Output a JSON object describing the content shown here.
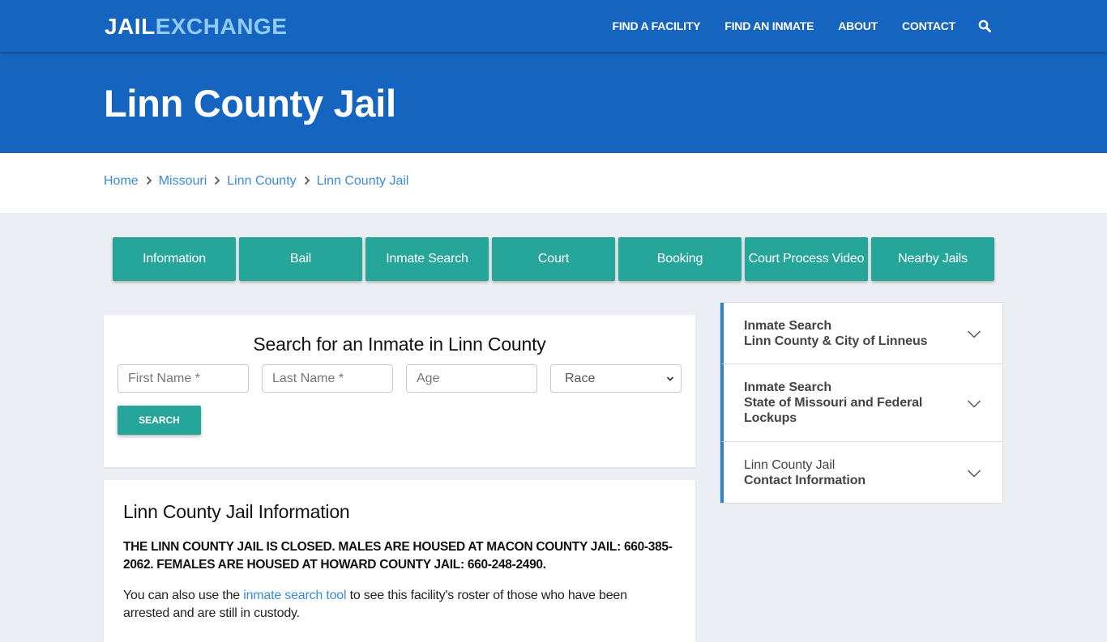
{
  "header": {
    "logo_part1": "JAIL",
    "logo_part2": "EXCHANGE",
    "nav": [
      {
        "label": "FIND A FACILITY"
      },
      {
        "label": "FIND AN INMATE"
      },
      {
        "label": "ABOUT"
      },
      {
        "label": "CONTACT"
      }
    ],
    "search_icon": "search-icon"
  },
  "hero": {
    "title": "Linn County Jail"
  },
  "breadcrumb": [
    {
      "label": "Home"
    },
    {
      "label": "Missouri"
    },
    {
      "label": "Linn County"
    },
    {
      "label": "Linn County Jail"
    }
  ],
  "tabs": [
    {
      "label": "Information"
    },
    {
      "label": "Bail"
    },
    {
      "label": "Inmate Search"
    },
    {
      "label": "Court"
    },
    {
      "label": "Booking"
    },
    {
      "label": "Court Process Video"
    },
    {
      "label": "Nearby Jails"
    }
  ],
  "search": {
    "title": "Search for an Inmate in Linn County",
    "first_name_placeholder": "First Name *",
    "last_name_placeholder": "Last Name *",
    "age_placeholder": "Age",
    "race_selected": "Race",
    "button_label": "SEARCH"
  },
  "info": {
    "title": "Linn County Jail Information",
    "alert": "THE LINN COUNTY JAIL IS CLOSED.  MALES ARE HOUSED AT MACON COUNTY JAIL: 660-385-2062.  FEMALES ARE HOUSED AT HOWARD COUNTY JAIL: 660-248-2490.",
    "para_before": "You can also use the ",
    "para_link": "inmate search tool",
    "para_after": " to see this facility's roster of those who have been arrested and are still in custody."
  },
  "sidebar": {
    "items": [
      {
        "line1": "Inmate Search",
        "line2": "Linn County & City of Linneus"
      },
      {
        "line1": "Inmate Search",
        "line2": "State of Missouri and Federal Lockups"
      },
      {
        "line1": "Linn County Jail",
        "line2": "Contact Information"
      }
    ]
  },
  "colors": {
    "header_blue": "#1565c0",
    "logo_accent": "#90caf9",
    "teal": "#26a69a",
    "link_blue": "#3a8bd8",
    "accordion_accent": "#2f80d4"
  }
}
